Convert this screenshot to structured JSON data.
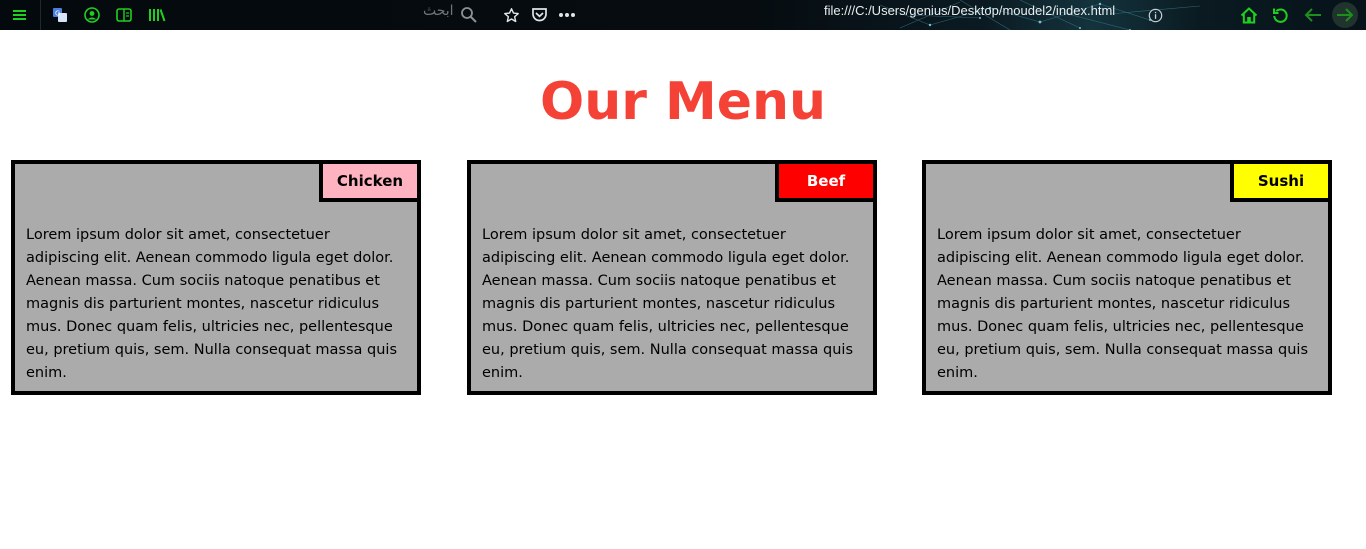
{
  "browser": {
    "search_placeholder": "ابحث",
    "url": "file:///C:/Users/genius/Desktop/moudel2/index.html",
    "icons": [
      "menu-icon",
      "translate-icon",
      "account-icon",
      "reader-icon",
      "library-icon",
      "search-icon",
      "bookmark-star-icon",
      "pocket-icon",
      "more-icon",
      "info-icon",
      "home-icon",
      "reload-icon",
      "back-icon",
      "forward-icon"
    ],
    "accent_color": "#1fd11f"
  },
  "page": {
    "title": "Our Menu",
    "title_color": "#f44336",
    "cards": [
      {
        "tag": "Chicken",
        "tag_color": "#ffb3c1",
        "tag_text_color": "#000000",
        "text": "Lorem ipsum dolor sit amet, consectetuer adipiscing elit. Aenean commodo ligula eget dolor. Aenean massa. Cum sociis natoque penatibus et magnis dis parturient montes, nascetur ridiculus mus. Donec quam felis, ultricies nec, pellentesque eu, pretium quis, sem. Nulla consequat massa quis enim."
      },
      {
        "tag": "Beef",
        "tag_color": "#ff0000",
        "tag_text_color": "#ffffff",
        "text": "Lorem ipsum dolor sit amet, consectetuer adipiscing elit. Aenean commodo ligula eget dolor. Aenean massa. Cum sociis natoque penatibus et magnis dis parturient montes, nascetur ridiculus mus. Donec quam felis, ultricies nec, pellentesque eu, pretium quis, sem. Nulla consequat massa quis enim."
      },
      {
        "tag": "Sushi",
        "tag_color": "#ffff00",
        "tag_text_color": "#000000",
        "text": "Lorem ipsum dolor sit amet, consectetuer adipiscing elit. Aenean commodo ligula eget dolor. Aenean massa. Cum sociis natoque penatibus et magnis dis parturient montes, nascetur ridiculus mus. Donec quam felis, ultricies nec, pellentesque eu, pretium quis, sem. Nulla consequat massa quis enim."
      }
    ],
    "card_background": "#ababab"
  }
}
